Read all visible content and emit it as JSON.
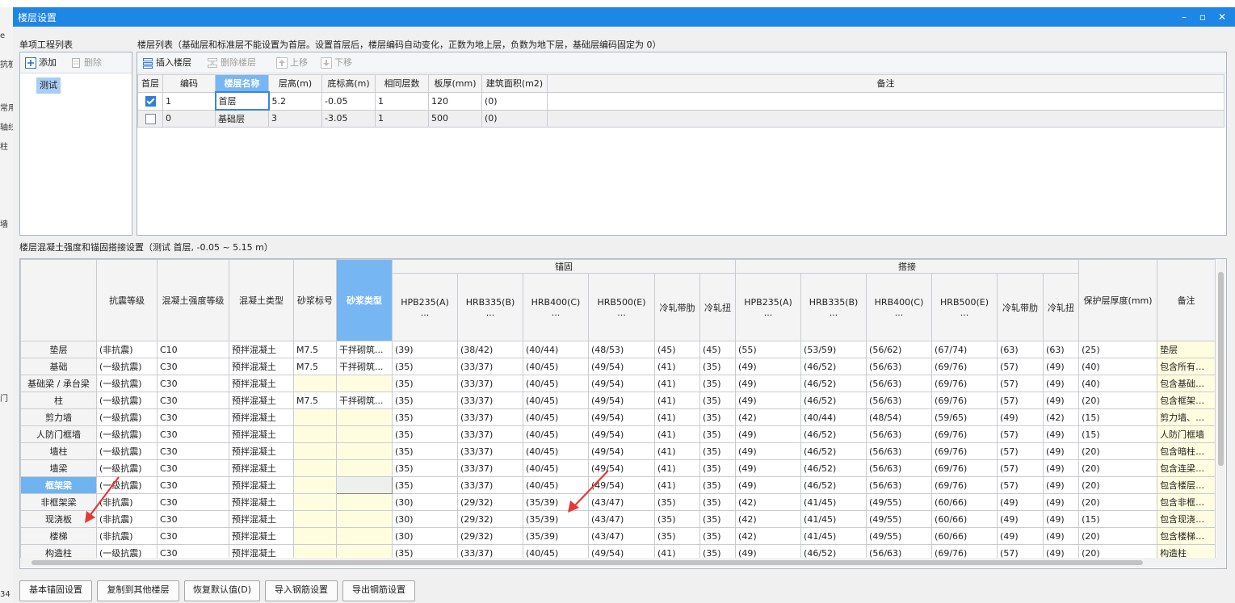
{
  "bg": {
    "left_fragments": [
      "e",
      "抗桩",
      "常用",
      "轴线",
      "柱",
      "墙",
      "门",
      "34"
    ]
  },
  "window": {
    "title": "楼层设置",
    "minimize_label": "–",
    "maximize_label": "▫",
    "close_label": "✕"
  },
  "left_panel": {
    "label": "单项工程列表",
    "add_label": "添加",
    "delete_label": "删除",
    "items": [
      "测试"
    ]
  },
  "floor_list": {
    "label": "楼层列表（基础层和标准层不能设置为首层。设置首层后，楼层编码自动变化，正数为地上层，负数为地下层，基础层编码固定为 0）",
    "toolbar": {
      "insert": "插入楼层",
      "delete": "删除楼层",
      "up": "上移",
      "down": "下移"
    },
    "headers": [
      "首层",
      "编码",
      "楼层名称",
      "层高(m)",
      "底标高(m)",
      "相同层数",
      "板厚(mm)",
      "建筑面积(m2)",
      "备注"
    ],
    "rows": [
      {
        "first": true,
        "code": "1",
        "name": "首层",
        "height": "5.2",
        "base": "-0.05",
        "same": "1",
        "thick": "120",
        "area": "(0)",
        "note": ""
      },
      {
        "first": false,
        "code": "0",
        "name": "基础层",
        "height": "3",
        "base": "-3.05",
        "same": "1",
        "thick": "500",
        "area": "(0)",
        "note": ""
      }
    ]
  },
  "strength": {
    "label": "楼层混凝土强度和锚固搭接设置（测试  首层, -0.05 ~ 5.15 m）",
    "headers": {
      "seismic": "抗震等级",
      "concrete_grade": "混凝土强度等级",
      "concrete_type": "混凝土类型",
      "mortar_grade": "砂浆标号",
      "mortar_type": "砂浆类型",
      "anchor": "锚固",
      "lap": "搭接",
      "sub": [
        "HPB235(A)",
        "HRB335(B)",
        "HRB400(C)",
        "HRB500(E)",
        "冷轧带肋",
        "冷轧扭"
      ],
      "ellipsis": "...",
      "cover": "保护层厚度(mm)",
      "note": "备注"
    },
    "rows": [
      [
        "垫层",
        "(非抗震)",
        "C10",
        "预拌混凝土",
        "M7.5",
        "干拌砌筑...",
        "(39)",
        "(38/42)",
        "(40/44)",
        "(48/53)",
        "(45)",
        "(45)",
        "(55)",
        "(53/59)",
        "(56/62)",
        "(67/74)",
        "(63)",
        "(63)",
        "(25)",
        "垫层"
      ],
      [
        "基础",
        "(一级抗震)",
        "C30",
        "预拌混凝土",
        "M7.5",
        "干拌砌筑...",
        "(35)",
        "(33/37)",
        "(40/45)",
        "(49/54)",
        "(41)",
        "(35)",
        "(49)",
        "(46/52)",
        "(56/63)",
        "(69/76)",
        "(57)",
        "(49)",
        "(40)",
        "包含所有的基"
      ],
      [
        "基础梁 / 承台梁",
        "(一级抗震)",
        "C30",
        "预拌混凝土",
        "",
        "",
        "(35)",
        "(33/37)",
        "(40/45)",
        "(49/54)",
        "(41)",
        "(35)",
        "(49)",
        "(46/52)",
        "(56/63)",
        "(69/76)",
        "(57)",
        "(49)",
        "(40)",
        "包含基础主梁"
      ],
      [
        "柱",
        "(一级抗震)",
        "C30",
        "预拌混凝土",
        "M7.5",
        "干拌砌筑...",
        "(35)",
        "(33/37)",
        "(40/45)",
        "(49/54)",
        "(41)",
        "(35)",
        "(49)",
        "(46/52)",
        "(56/63)",
        "(69/76)",
        "(57)",
        "(49)",
        "(20)",
        "包含框架柱、"
      ],
      [
        "剪力墙",
        "(一级抗震)",
        "C30",
        "预拌混凝土",
        "",
        "",
        "(35)",
        "(33/37)",
        "(40/45)",
        "(49/54)",
        "(41)",
        "(35)",
        "(42)",
        "(40/44)",
        "(48/54)",
        "(59/65)",
        "(49)",
        "(42)",
        "(15)",
        "剪力墙、预制"
      ],
      [
        "人防门框墙",
        "(一级抗震)",
        "C30",
        "预拌混凝土",
        "",
        "",
        "(35)",
        "(33/37)",
        "(40/45)",
        "(49/54)",
        "(41)",
        "(35)",
        "(49)",
        "(46/52)",
        "(56/63)",
        "(69/76)",
        "(57)",
        "(49)",
        "(15)",
        "人防门框墙"
      ],
      [
        "墙柱",
        "(一级抗震)",
        "C30",
        "预拌混凝土",
        "",
        "",
        "(35)",
        "(33/37)",
        "(40/45)",
        "(49/54)",
        "(41)",
        "(35)",
        "(49)",
        "(46/52)",
        "(56/63)",
        "(69/76)",
        "(57)",
        "(49)",
        "(20)",
        "包含暗柱、端"
      ],
      [
        "墙梁",
        "(一级抗震)",
        "C30",
        "预拌混凝土",
        "",
        "",
        "(35)",
        "(33/37)",
        "(40/45)",
        "(49/54)",
        "(41)",
        "(35)",
        "(49)",
        "(46/52)",
        "(56/63)",
        "(69/76)",
        "(57)",
        "(49)",
        "(20)",
        "包含连梁、暗"
      ],
      [
        "框架梁",
        "(一级抗震)",
        "C30",
        "预拌混凝土",
        "",
        "",
        "(35)",
        "(33/37)",
        "(40/45)",
        "(49/54)",
        "(41)",
        "(35)",
        "(49)",
        "(46/52)",
        "(56/63)",
        "(69/76)",
        "(57)",
        "(49)",
        "(20)",
        "包含楼层框架"
      ],
      [
        "非框架梁",
        "(非抗震)",
        "C30",
        "预拌混凝土",
        "",
        "",
        "(30)",
        "(29/32)",
        "(35/39)",
        "(43/47)",
        "(35)",
        "(35)",
        "(42)",
        "(41/45)",
        "(49/55)",
        "(60/66)",
        "(49)",
        "(49)",
        "(20)",
        "包含非框架梁"
      ],
      [
        "现浇板",
        "(非抗震)",
        "C30",
        "预拌混凝土",
        "",
        "",
        "(30)",
        "(29/32)",
        "(35/39)",
        "(43/47)",
        "(35)",
        "(35)",
        "(42)",
        "(41/45)",
        "(49/55)",
        "(60/66)",
        "(49)",
        "(49)",
        "(15)",
        "包含现浇板、"
      ],
      [
        "楼梯",
        "(非抗震)",
        "C30",
        "预拌混凝土",
        "",
        "",
        "(30)",
        "(29/32)",
        "(35/39)",
        "(43/47)",
        "(35)",
        "(35)",
        "(42)",
        "(41/45)",
        "(49/55)",
        "(60/66)",
        "(49)",
        "(49)",
        "(20)",
        "包含楼梯、直"
      ],
      [
        "构造柱",
        "(一级抗震)",
        "C30",
        "预拌混凝土",
        "",
        "",
        "(35)",
        "(33/37)",
        "(40/45)",
        "(49/54)",
        "(41)",
        "(35)",
        "(49)",
        "(46/52)",
        "(56/63)",
        "(69/76)",
        "(57)",
        "(49)",
        "(20)",
        "构造柱"
      ]
    ]
  },
  "buttons": [
    "基本锚固设置",
    "复制到其他楼层",
    "恢复默认值(D)",
    "导入钢筋设置",
    "导出钢筋设置"
  ],
  "colors": {
    "title_bar": "#1e86e4",
    "header_blue": "#76b6f3",
    "note_yellow": "#fffde0",
    "arrow_red": "#e53935"
  }
}
